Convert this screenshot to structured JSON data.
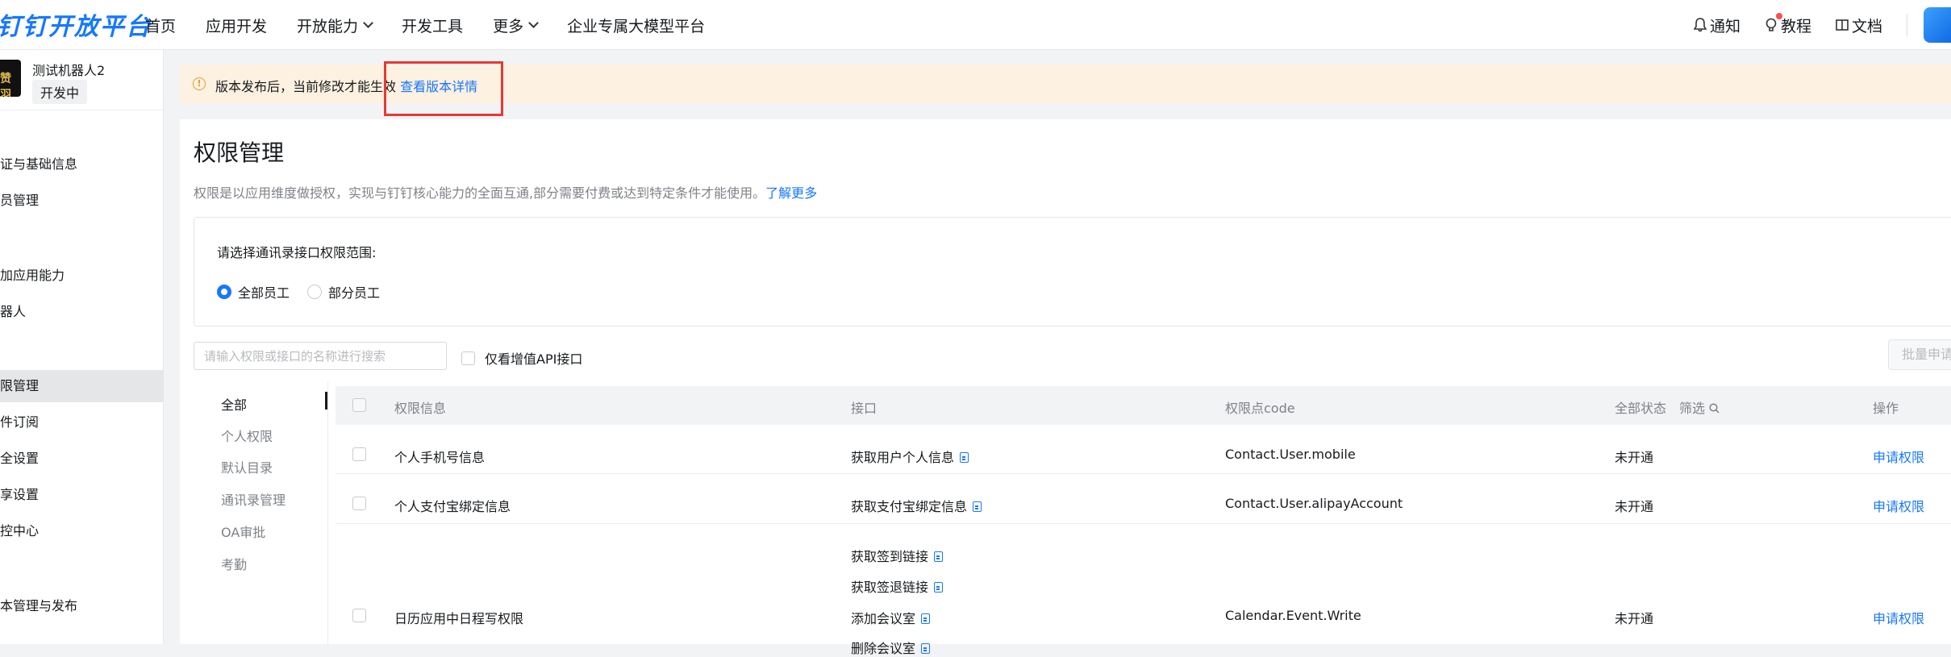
{
  "topbar": {
    "logo": "钉钉开放平台",
    "nav": [
      "首页",
      "应用开发",
      "开放能力",
      "开发工具",
      "更多",
      "企业专属大模型平台"
    ],
    "right": {
      "notify": "通知",
      "tutorial": "教程",
      "docs": "文档"
    }
  },
  "sidebar": {
    "robot_name": "测试机器人2",
    "robot_status": "开发中",
    "thumb_text": "赞羽",
    "items": [
      "证与基础信息",
      "员管理",
      "加应用能力",
      "器人",
      "限管理",
      "件订阅",
      "全设置",
      "享设置",
      "控中心",
      "本管理与发布"
    ]
  },
  "banner": {
    "text": "版本发布后，当前修改才能生效",
    "link": "查看版本详情"
  },
  "main": {
    "title": "权限管理",
    "desc": "权限是以应用维度做授权，实现与钉钉核心能力的全面互通,部分需要付费或达到特定条件才能使用。",
    "desc_link": "了解更多",
    "scope_title": "请选择通讯录接口权限范围:",
    "scope_all": "全部员工",
    "scope_partial": "部分员工",
    "search_placeholder": "请输入权限或接口的名称进行搜索",
    "only_value_api": "仅看增值API接口",
    "batch_button": "批量申请"
  },
  "categories": [
    "全部",
    "个人权限",
    "默认目录",
    "通讯录管理",
    "OA审批",
    "考勤"
  ],
  "table": {
    "headers": {
      "info": "权限信息",
      "api": "接口",
      "code": "权限点code",
      "status": "全部状态",
      "filter": "筛选",
      "op": "操作"
    },
    "rows": [
      {
        "info": "个人手机号信息",
        "apis": [
          "获取用户个人信息"
        ],
        "code": "Contact.User.mobile",
        "status": "未开通",
        "op": "申请权限"
      },
      {
        "info": "个人支付宝绑定信息",
        "apis": [
          "获取支付宝绑定信息"
        ],
        "code": "Contact.User.alipayAccount",
        "status": "未开通",
        "op": "申请权限"
      },
      {
        "info": "日历应用中日程写权限",
        "apis": [
          "获取签到链接",
          "获取签退链接",
          "添加会议室",
          "删除会议室"
        ],
        "code": "Calendar.Event.Write",
        "status": "未开通",
        "op": "申请权限"
      }
    ]
  },
  "colors": {
    "accent": "#1677ff",
    "banner_bg": "#fdf1e1",
    "highlight": "#e53935"
  }
}
